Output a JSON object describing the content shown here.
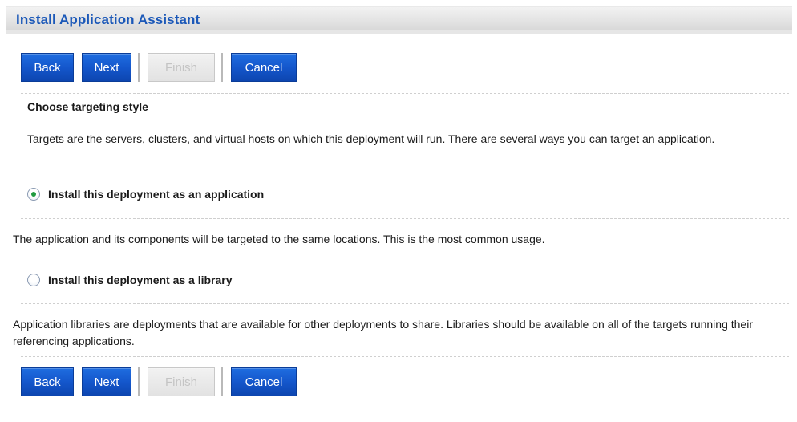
{
  "window": {
    "title": "Install Application Assistant"
  },
  "buttons": {
    "back": "Back",
    "next": "Next",
    "finish": "Finish",
    "cancel": "Cancel"
  },
  "section": {
    "heading": "Choose targeting style",
    "intro": "Targets are the servers, clusters, and virtual hosts on which this deployment will run. There are several ways you can target an application."
  },
  "options": [
    {
      "label": "Install this deployment as an application",
      "selected": true,
      "description": "The application and its components will be targeted to the same locations. This is the most common usage."
    },
    {
      "label": "Install this deployment as a library",
      "selected": false,
      "description": "Application libraries are deployments that are available for other deployments to share. Libraries should be available on all of the targets running their referencing applications."
    }
  ],
  "colors": {
    "title_text": "#1b58b8",
    "button_bg": "#1457cc",
    "disabled_button_text": "#c4c4c4",
    "radio_selected_dot": "#1f9a3f"
  }
}
